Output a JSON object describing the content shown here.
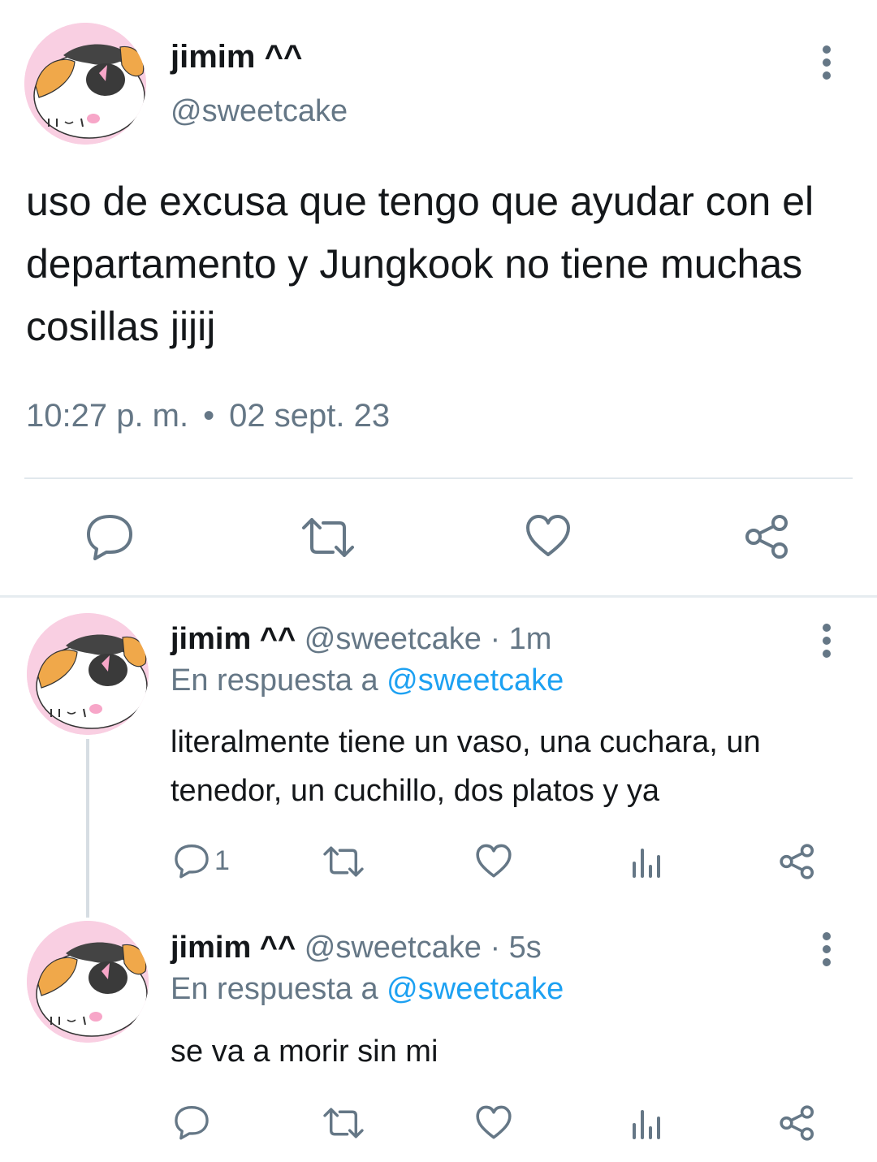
{
  "main_tweet": {
    "display_name": "jimim ^^",
    "handle": "@sweetcake",
    "text": "uso de excusa que tengo que ayudar con el departamento y Jungkook no tiene muchas cosillas jijij",
    "time": "10:27 p. m.",
    "separator": "•",
    "date": "02 sept. 23"
  },
  "replies": [
    {
      "display_name": "jimim ^^",
      "handle": "@sweetcake",
      "separator": "·",
      "time": "1m",
      "reply_prefix": "En respuesta a",
      "reply_to": "@sweetcake",
      "text": "literalmente tiene un vaso, una cuchara, un tenedor, un cuchillo, dos platos y ya",
      "reply_count": "1"
    },
    {
      "display_name": "jimim ^^",
      "handle": "@sweetcake",
      "separator": "·",
      "time": "5s",
      "reply_prefix": "En respuesta a",
      "reply_to": "@sweetcake",
      "text": "se va a morir sin mi",
      "reply_count": ""
    }
  ],
  "icons": {
    "reply": "reply-icon",
    "retweet": "retweet-icon",
    "like": "heart-icon",
    "views": "views-icon",
    "share": "share-icon",
    "more": "more-vertical-icon"
  },
  "colors": {
    "primary_text": "#14171a",
    "secondary_text": "#657786",
    "link": "#1da1f2",
    "divider": "#e1e8ed",
    "avatar_ring": "#f5b6d3"
  }
}
